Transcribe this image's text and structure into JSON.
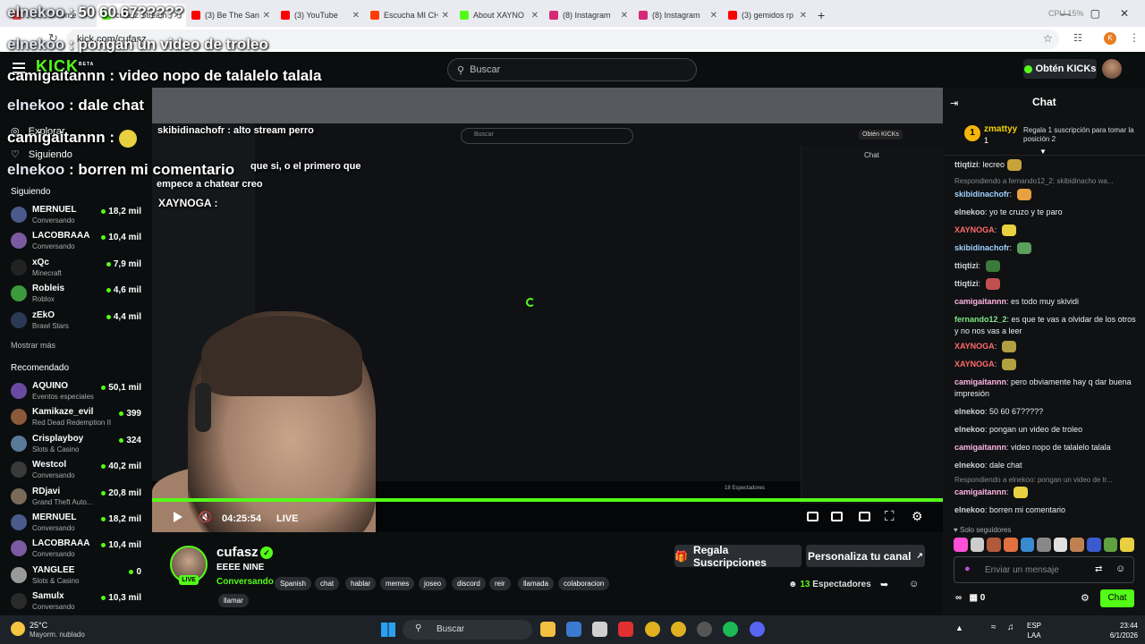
{
  "browser": {
    "tabs": [
      {
        "label": "7TV - Chrome",
        "color": "#ff4d4d",
        "active": false
      },
      {
        "label": "cufasz Stream",
        "color": "#53fc18",
        "active": true
      },
      {
        "label": "(3) Be The Sant",
        "color": "#ff0000",
        "active": false
      },
      {
        "label": "(3) YouTube",
        "color": "#ff0000",
        "active": false
      },
      {
        "label": "Escucha MI CH",
        "color": "#ff3c00",
        "active": false
      },
      {
        "label": "About XAYNO",
        "color": "#53fc18",
        "active": false
      },
      {
        "label": "(8) Instagram",
        "color": "#d62976",
        "active": false
      },
      {
        "label": "(8) Instagram",
        "color": "#d62976",
        "active": false
      },
      {
        "label": "(3) gemidos rp",
        "color": "#ff0000",
        "active": false
      }
    ],
    "new_tab": "+",
    "cpu": "CPU 15%",
    "url": "kick.com/cufasz",
    "profile_initial": "K"
  },
  "header": {
    "logo": "KICK",
    "logo_beta": "BETA",
    "search_placeholder": "Buscar",
    "get_kicks": "Obtén KICKs"
  },
  "sidebar": {
    "nav": [
      {
        "label": "Explorar",
        "icon": "compass-icon"
      },
      {
        "label": "Siguiendo",
        "icon": "heart-icon"
      }
    ],
    "following_title": "Siguiendo",
    "following": [
      {
        "name": "MERNUEL",
        "category": "Conversando",
        "viewers": "18,2 mil",
        "color": "#4a5a8a"
      },
      {
        "name": "LACOBRAAA",
        "category": "Conversando",
        "viewers": "10,4 mil",
        "color": "#7a5aa0"
      },
      {
        "name": "xQc",
        "category": "Minecraft",
        "viewers": "7,9 mil",
        "color": "#222222"
      },
      {
        "name": "Robleis",
        "category": "Roblox",
        "viewers": "4,6 mil",
        "color": "#3b9a3b"
      },
      {
        "name": "zEkO",
        "category": "Brawl Stars",
        "viewers": "4,4 mil",
        "color": "#2a3a55"
      }
    ],
    "show_more": "Mostrar más",
    "recommended_title": "Recomendado",
    "recommended": [
      {
        "name": "AQUINO",
        "category": "Eventos especiales",
        "viewers": "50,1 mil",
        "color": "#6a4aa0"
      },
      {
        "name": "Kamikaze_evil",
        "category": "Red Dead Redemption II",
        "viewers": "399",
        "color": "#8a5a3a"
      },
      {
        "name": "Crisplayboy",
        "category": "Slots & Casino",
        "viewers": "324",
        "color": "#5a7a9a"
      },
      {
        "name": "Westcol",
        "category": "Conversando",
        "viewers": "40,2 mil",
        "color": "#3a3a3a"
      },
      {
        "name": "RDjavi",
        "category": "Grand Theft Auto...",
        "viewers": "20,8 mil",
        "color": "#7a6a5a"
      },
      {
        "name": "MERNUEL",
        "category": "Conversando",
        "viewers": "18,2 mil",
        "color": "#4a5a8a"
      },
      {
        "name": "LACOBRAAA",
        "category": "Conversando",
        "viewers": "10,4 mil",
        "color": "#7a5aa0"
      },
      {
        "name": "YANGLEE",
        "category": "Slots & Casino",
        "viewers": "0",
        "color": "#9a9a9a"
      },
      {
        "name": "Samulx",
        "category": "Conversando",
        "viewers": "10,3 mil",
        "color": "#2a2a2a"
      }
    ]
  },
  "overlay_chat": [
    {
      "user": "elnekoo",
      "text": "50 60 67?????"
    },
    {
      "user": "elnekoo",
      "text": "pongan un video de troleo"
    },
    {
      "user": "camigaitannn",
      "text": "video nopo de talalelo talala"
    },
    {
      "user": "elnekoo",
      "text": "dale chat"
    },
    {
      "user": "camigaitannn",
      "text": ""
    },
    {
      "user": "elnekoo",
      "text": "borren mi comentario"
    }
  ],
  "inner_stream": {
    "search": "Buscar",
    "chat_title": "Chat",
    "get_kicks": "Obtén KICKs",
    "overlay": [
      {
        "text": "skibidinachofr : alto stream perro"
      },
      {
        "text": "que si, o el primero que"
      },
      {
        "text": "empece a chatear creo"
      },
      {
        "text": "XAYNOGA :"
      }
    ],
    "viewers": "18 Espectadores"
  },
  "player": {
    "time": "04:25:54",
    "live": "LIVE"
  },
  "channel": {
    "name": "cufasz",
    "title": "EEEE NINE",
    "category": "Conversando",
    "live_badge": "LIVE",
    "tags": [
      "Spanish",
      "chat",
      "hablar",
      "memes",
      "joseo",
      "discord",
      "reir",
      "llamada",
      "colaboracion",
      "llamar"
    ],
    "subs_button": "Regala Suscripciones",
    "customize_button": "Personaliza tu canal",
    "viewers_count": "13",
    "viewers_label": "Espectadores"
  },
  "chat": {
    "title": "Chat",
    "pinned": {
      "rank": "1",
      "user": "zmattyy",
      "count": "1",
      "text": "Regala 1 suscripción para tomar la posición 2"
    },
    "messages": [
      {
        "type": "msg",
        "user": "ttiqtizi",
        "color": "#cfd3d6",
        "text": "lecreo",
        "emote": "#c9a23a"
      },
      {
        "type": "reply",
        "text": "Respondiendo a fernando12_2: skibidinacho wa..."
      },
      {
        "type": "msg",
        "user": "skibidinachofr",
        "color": "#9fd2ff",
        "text": "",
        "emote": "#e8a040"
      },
      {
        "type": "msg",
        "user": "elnekoo",
        "color": "#cfd3d6",
        "text": "yo te cruzo y te paro"
      },
      {
        "type": "msg",
        "user": "XAYNOGA",
        "color": "#ff6b6b",
        "text": "",
        "emote": "#e8d040"
      },
      {
        "type": "msg",
        "user": "skibidinachofr",
        "color": "#9fd2ff",
        "text": "",
        "emote": "#5aa05a"
      },
      {
        "type": "msg",
        "user": "ttiqtizi",
        "color": "#cfd3d6",
        "text": "",
        "emote": "#3a7a3a"
      },
      {
        "type": "msg",
        "user": "ttiqtizi",
        "color": "#cfd3d6",
        "text": "",
        "emote": "#c05050"
      },
      {
        "type": "msg",
        "user": "camigaitannn",
        "color": "#ffb6e6",
        "text": "es todo muy skividi"
      },
      {
        "type": "msg",
        "user": "fernando12_2",
        "color": "#7ee787",
        "text": "es que te vas a olvidar de los otros y no nos vas a leer"
      },
      {
        "type": "msg",
        "user": "XAYNOGA",
        "color": "#ff6b6b",
        "text": "",
        "emote": "#b0a040"
      },
      {
        "type": "msg",
        "user": "XAYNOGA",
        "color": "#ff6b6b",
        "text": "",
        "emote": "#b0a040"
      },
      {
        "type": "msg",
        "user": "camigaitannn",
        "color": "#ffb6e6",
        "text": "pero obviamente hay q dar buena impresión"
      },
      {
        "type": "msg",
        "user": "elnekoo",
        "color": "#cfd3d6",
        "text": "50 60 67?????"
      },
      {
        "type": "msg",
        "user": "elnekoo",
        "color": "#cfd3d6",
        "text": "pongan un video de troleo"
      },
      {
        "type": "msg",
        "user": "camigaitannn",
        "color": "#ffb6e6",
        "text": "video nopo de talalelo talala"
      },
      {
        "type": "msg",
        "user": "elnekoo",
        "color": "#cfd3d6",
        "text": "dale chat"
      },
      {
        "type": "reply",
        "text": "Respondiendo a elnekoo: pongan un video de tr..."
      },
      {
        "type": "msg",
        "user": "camigaitannn",
        "color": "#ffb6e6",
        "text": "",
        "emote": "#e8d040"
      },
      {
        "type": "msg",
        "user": "elnekoo",
        "color": "#cfd3d6",
        "text": "borren mi comentario"
      }
    ],
    "followers_only": "Solo seguidores",
    "input_placeholder": "Enviar un mensaje",
    "footer_count": "0",
    "send_button": "Chat"
  },
  "taskbar": {
    "temp": "25°C",
    "weather": "Mayorm. nublado",
    "search": "Buscar",
    "lang_top": "ESP",
    "lang_bottom": "LAA",
    "time": "23:44",
    "date": "6/1/2026"
  }
}
